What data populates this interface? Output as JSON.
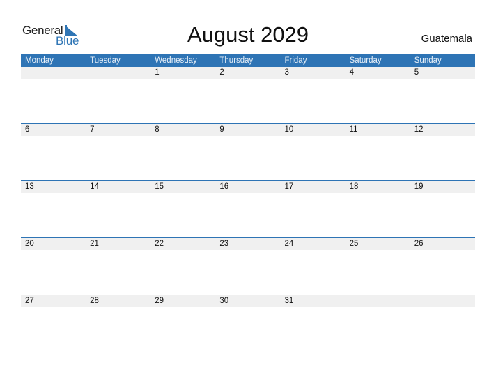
{
  "logo": {
    "word1": "General",
    "word2": "Blue"
  },
  "title": "August 2029",
  "country": "Guatemala",
  "colors": {
    "accent": "#2e74b5",
    "strip": "#f0f0f0"
  },
  "weekdays": [
    "Monday",
    "Tuesday",
    "Wednesday",
    "Thursday",
    "Friday",
    "Saturday",
    "Sunday"
  ],
  "weeks": [
    [
      "",
      "",
      "1",
      "2",
      "3",
      "4",
      "5"
    ],
    [
      "6",
      "7",
      "8",
      "9",
      "10",
      "11",
      "12"
    ],
    [
      "13",
      "14",
      "15",
      "16",
      "17",
      "18",
      "19"
    ],
    [
      "20",
      "21",
      "22",
      "23",
      "24",
      "25",
      "26"
    ],
    [
      "27",
      "28",
      "29",
      "30",
      "31",
      "",
      ""
    ]
  ]
}
